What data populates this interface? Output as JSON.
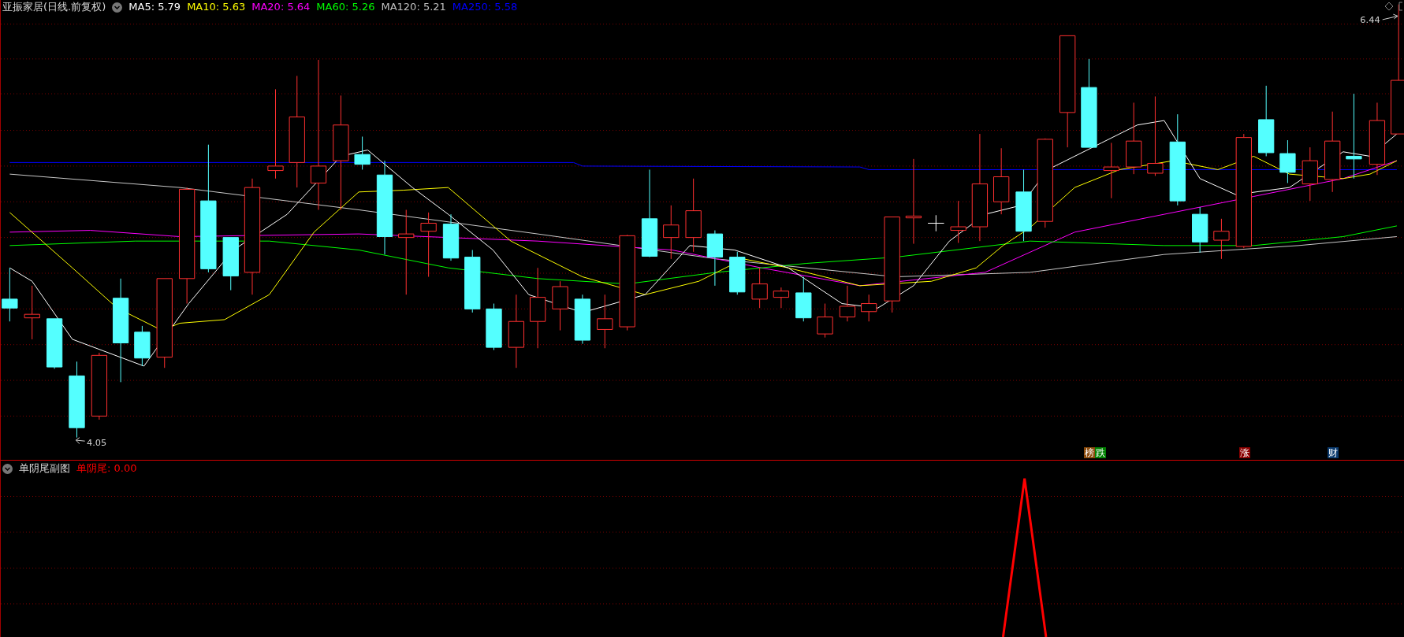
{
  "main_panel": {
    "title": "亚振家居(日线.前复权)",
    "indicators": [
      {
        "label": "MA5: 5.79",
        "color": "#ffffff"
      },
      {
        "label": "MA10: 5.63",
        "color": "#ffff00"
      },
      {
        "label": "MA20: 5.64",
        "color": "#ff00ff"
      },
      {
        "label": "MA60: 5.26",
        "color": "#00ff00"
      },
      {
        "label": "MA120: 5.21",
        "color": "#c0c0c0"
      },
      {
        "label": "MA250: 5.58",
        "color": "#0000ff"
      }
    ],
    "high_label": "6.44",
    "low_label": "4.05",
    "event_markers": [
      {
        "text": "榜",
        "color": "#8b4a0b"
      },
      {
        "text": "跌",
        "color": "#008000"
      },
      {
        "text": "涨",
        "color": "#8b0000"
      },
      {
        "text": "财",
        "color": "#0a3a6e"
      }
    ]
  },
  "sub_panel": {
    "title": "单阴尾副图",
    "indicator": {
      "label": "单阴尾: 0.00",
      "color": "#ff0000"
    }
  }
}
